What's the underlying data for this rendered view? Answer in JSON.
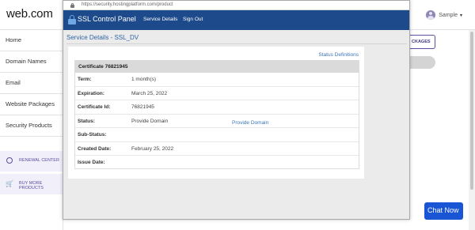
{
  "site": {
    "logo": "web.com",
    "user_name": "Sample",
    "caret": "▾",
    "nav": [
      "Home",
      "Domain Names",
      "Email",
      "Website Packages",
      "Security Products"
    ],
    "renewal_center": "RENEWAL CENTER",
    "buy_more": "BUY MORE PRODUCTS",
    "packages_fragment": "CKAGES",
    "chat_label": "Chat Now"
  },
  "popup": {
    "url": "https://security.hostingplatform.com/product",
    "header": {
      "title": "SSL Control Panel",
      "nav": [
        "Service Details",
        "Sign Out"
      ]
    },
    "page_title": "Service Details - SSL_DV",
    "status_definitions": "Status Definitions",
    "table": {
      "header": "Certificate 76821945",
      "rows": [
        {
          "label": "Term:",
          "value": "1 month(s)",
          "action": ""
        },
        {
          "label": "Expiration:",
          "value": "March 25, 2022",
          "action": ""
        },
        {
          "label": "Certificate Id:",
          "value": "76821945",
          "action": ""
        },
        {
          "label": "Status:",
          "value": "Provide Domain",
          "action": "Provide Domain"
        },
        {
          "label": "Sub-Status:",
          "value": "",
          "action": ""
        },
        {
          "label": "Created Date:",
          "value": "February 25, 2022",
          "action": ""
        },
        {
          "label": "Issue Date:",
          "value": "",
          "action": ""
        }
      ]
    }
  },
  "colors": {
    "brand_purple": "#5a4fa0",
    "ssl_header_blue": "#1d4a8a",
    "link_blue": "#3a74b8",
    "chat_blue": "#1a55d6"
  }
}
